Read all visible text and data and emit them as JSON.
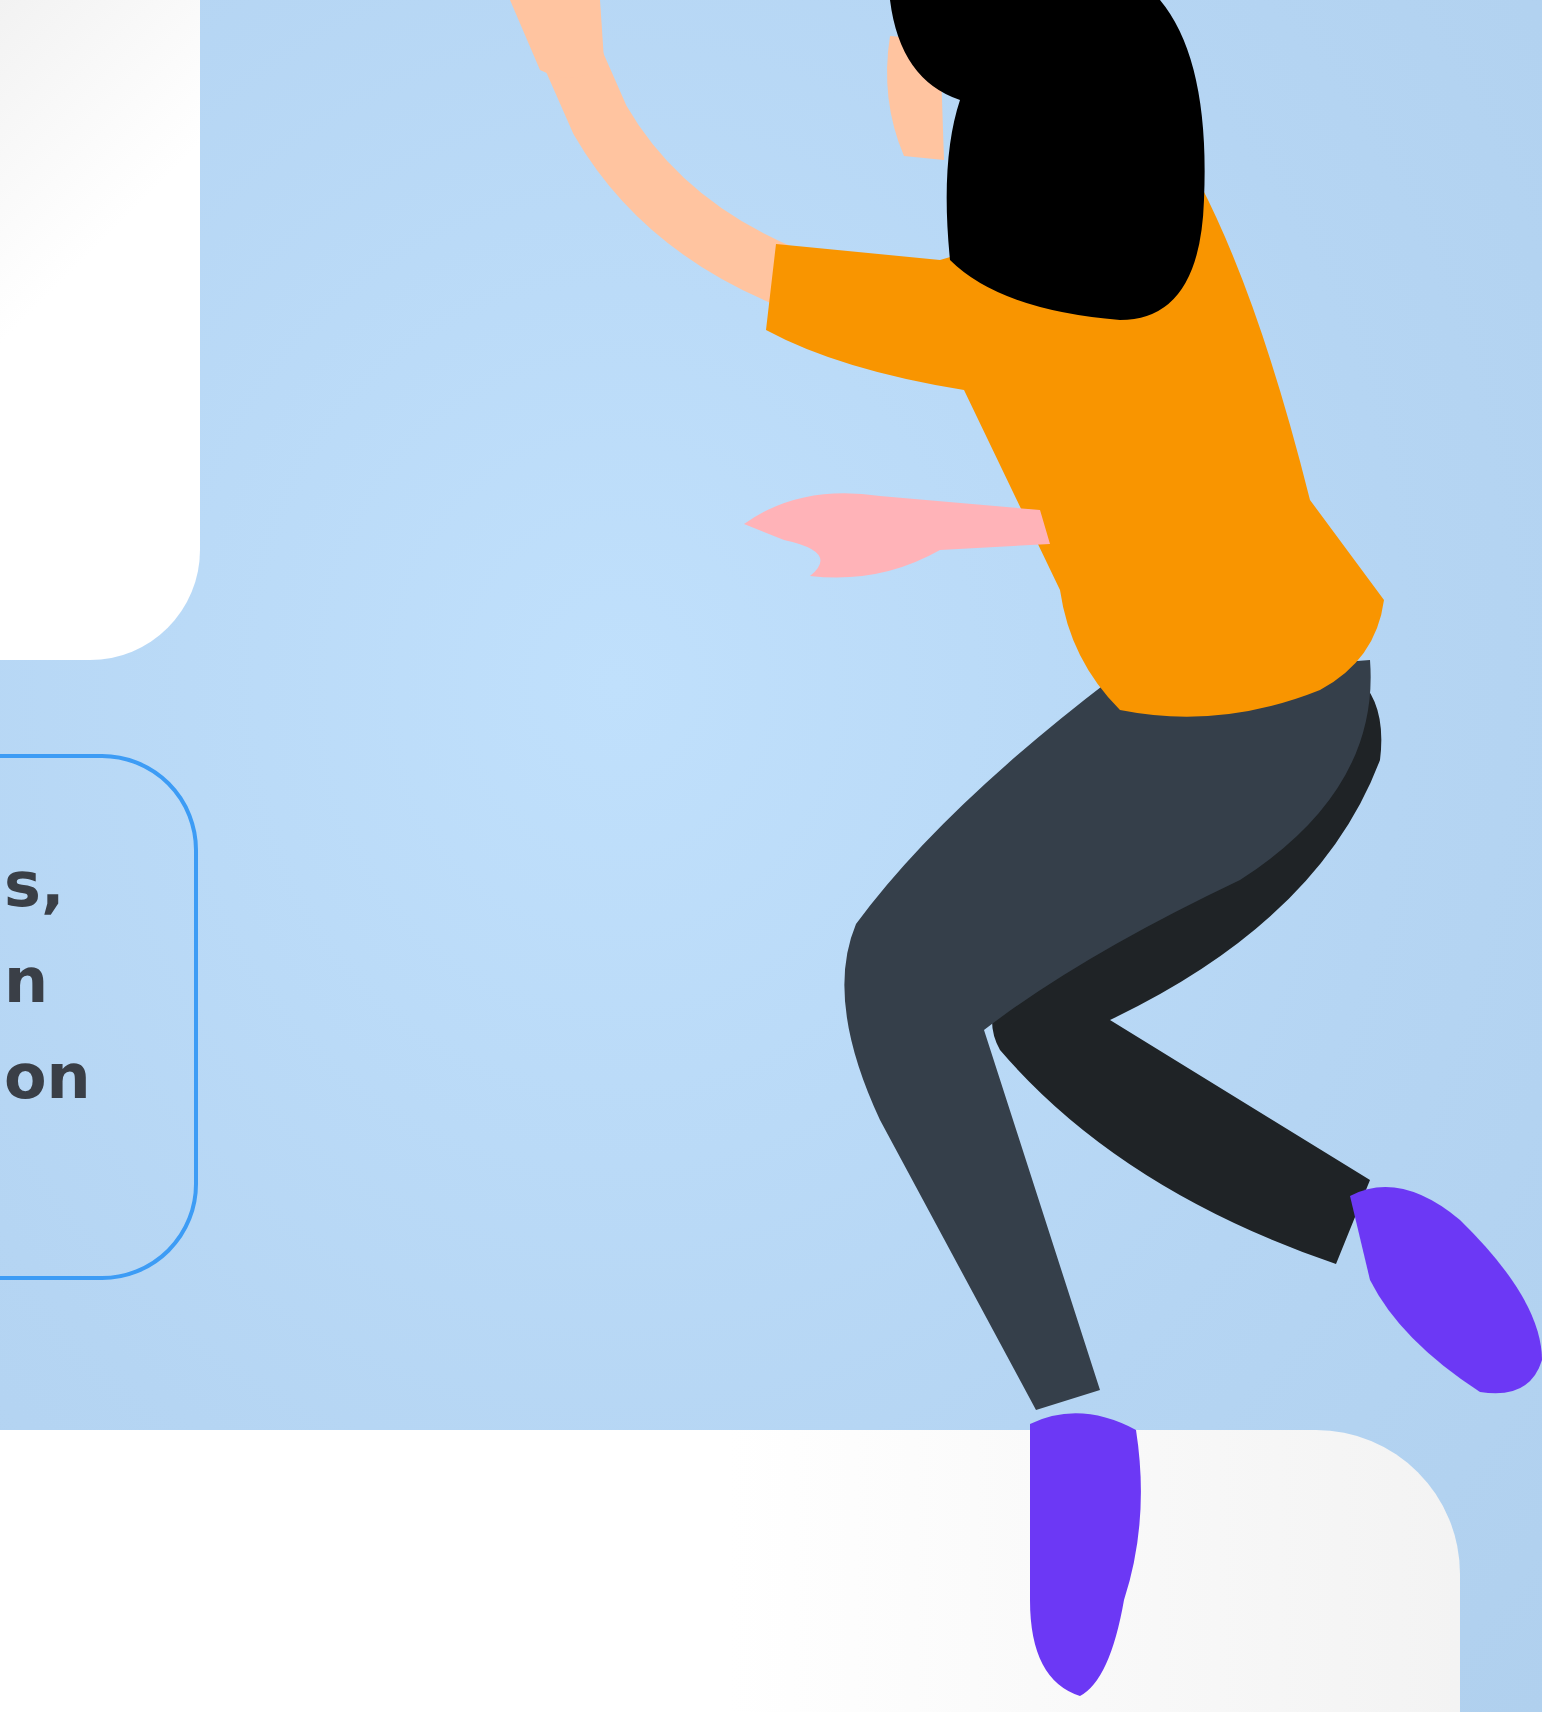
{
  "callout": {
    "text_lines": [
      "s,",
      "n",
      "on"
    ]
  }
}
